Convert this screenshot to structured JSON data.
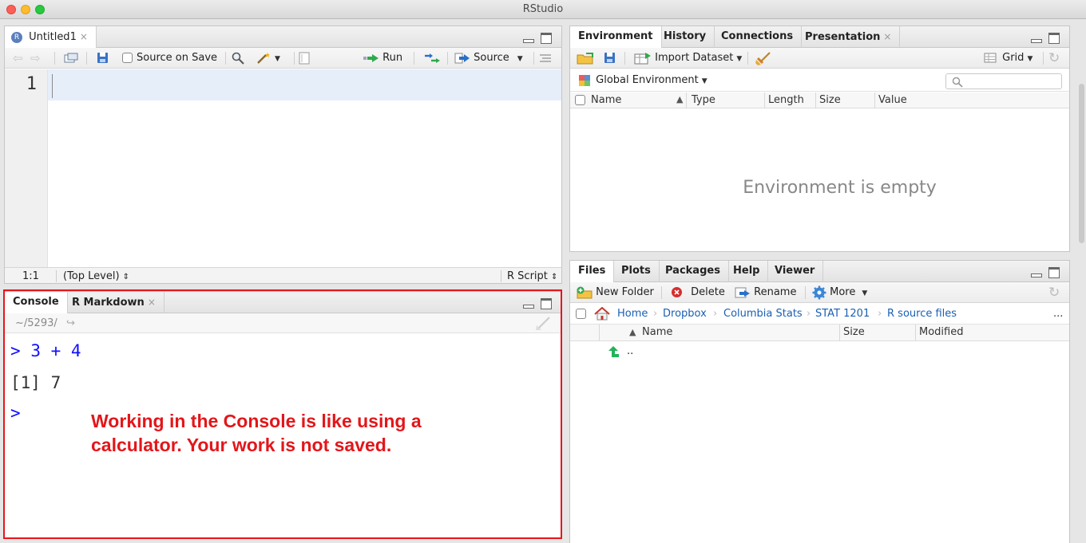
{
  "window": {
    "title": "RStudio"
  },
  "source_pane": {
    "tab_label": "Untitled1",
    "source_on_save_label": "Source on Save",
    "run_label": "Run",
    "source_label": "Source",
    "line_number": "1",
    "cursor_position": "1:1",
    "scope": "(Top Level)",
    "file_type": "R Script"
  },
  "console_pane": {
    "tabs": [
      "Console",
      "R Markdown"
    ],
    "working_dir": "~/5293/",
    "lines": [
      {
        "prompt": ">",
        "text": "3 + 4"
      },
      {
        "prompt": "",
        "text": "[1] 7"
      },
      {
        "prompt": ">",
        "text": ""
      }
    ]
  },
  "annotation": {
    "line1": "Working in the Console is like using a",
    "line2": "calculator. Your work is not saved.",
    "color": "#e3161a"
  },
  "environment_pane": {
    "tabs": [
      "Environment",
      "History",
      "Connections",
      "Presentation"
    ],
    "import_dataset_label": "Import Dataset",
    "grid_label": "Grid",
    "scope_label": "Global Environment",
    "columns": [
      "Name",
      "Type",
      "Length",
      "Size",
      "Value"
    ],
    "empty_message": "Environment is empty"
  },
  "files_pane": {
    "tabs": [
      "Files",
      "Plots",
      "Packages",
      "Help",
      "Viewer"
    ],
    "new_folder_label": "New Folder",
    "delete_label": "Delete",
    "rename_label": "Rename",
    "more_label": "More",
    "breadcrumb": [
      "Home",
      "Dropbox",
      "Columbia Stats",
      "STAT 1201",
      "R source files"
    ],
    "more_dots": "...",
    "columns": [
      "Name",
      "Size",
      "Modified"
    ],
    "rows": [
      {
        "name": ".."
      }
    ]
  },
  "colors": {
    "link": "#1a5fb4",
    "prompt": "#1010ff",
    "highlight": "#e3161a"
  }
}
